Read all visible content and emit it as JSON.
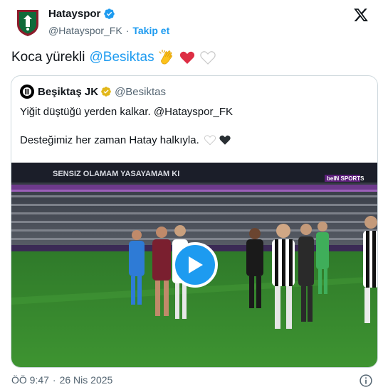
{
  "author": {
    "display_name": "Hatayspor",
    "handle": "@Hatayspor_FK",
    "follow_label": "Takip et",
    "separator": "·"
  },
  "tweet": {
    "text": "Koca yürekli",
    "mention": "@Besiktas",
    "emojis": [
      "clapping-hands-icon",
      "red-heart-icon",
      "white-heart-icon"
    ]
  },
  "quoted": {
    "display_name": "Beşiktaş JK",
    "handle": "@Besiktas",
    "line1": "Yiğit düştüğü yerden kalkar. @Hatayspor_FK",
    "line2": "Desteğimiz her zaman Hatay halkıyla.",
    "line2_emojis": [
      "white-heart-icon",
      "black-heart-icon"
    ],
    "media": {
      "type": "video",
      "stadium_banner": "SENSIZ OLAMAM YASAYAMAM KI",
      "broadcaster": "beIN SPORTS"
    }
  },
  "footer": {
    "time": "ÖÖ 9:47",
    "separator": "·",
    "date": "26 Nis 2025"
  },
  "colors": {
    "accent": "#1d9bf0",
    "text": "#0f1419",
    "muted": "#536471",
    "border": "#cfd9de"
  }
}
